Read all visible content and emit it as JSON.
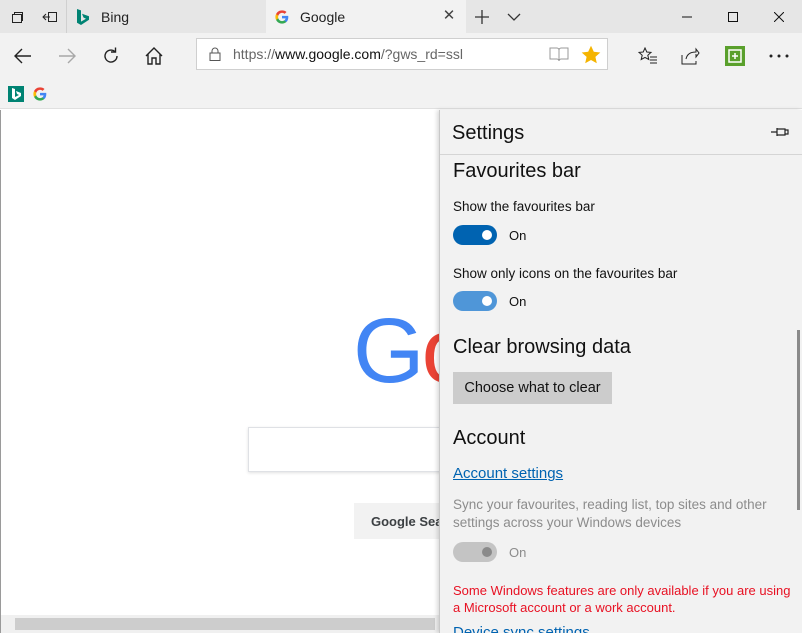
{
  "tabs": [
    {
      "label": "Bing",
      "favicon": "bing-icon",
      "active": false
    },
    {
      "label": "Google",
      "favicon": "google-icon",
      "active": true
    }
  ],
  "address": {
    "url_prefix": "https://",
    "url_host": "www.google.com",
    "url_path": "/?gws_rd=ssl"
  },
  "page": {
    "logo_visible": "Go",
    "search_button_label": "Google Sea"
  },
  "settings": {
    "title": "Settings",
    "favourites_bar": {
      "heading": "Favourites bar",
      "show_bar_label": "Show the favourites bar",
      "show_bar_state": "On",
      "icons_only_label": "Show only icons on the favourites bar",
      "icons_only_state": "On"
    },
    "clear_data": {
      "heading": "Clear browsing data",
      "button_label": "Choose what to clear"
    },
    "account": {
      "heading": "Account",
      "link_label": "Account settings",
      "sync_desc": "Sync your favourites, reading list, top sites and other settings across your Windows devices",
      "sync_state": "On",
      "warning": "Some Windows features are only available if you are using a Microsoft account or a work account.",
      "device_sync_link": "Device sync settings"
    }
  },
  "colors": {
    "accent": "#0063b1",
    "toggle_light": "#4f96d8",
    "warning": "#e81123",
    "favorite_star": "#f5b400"
  }
}
